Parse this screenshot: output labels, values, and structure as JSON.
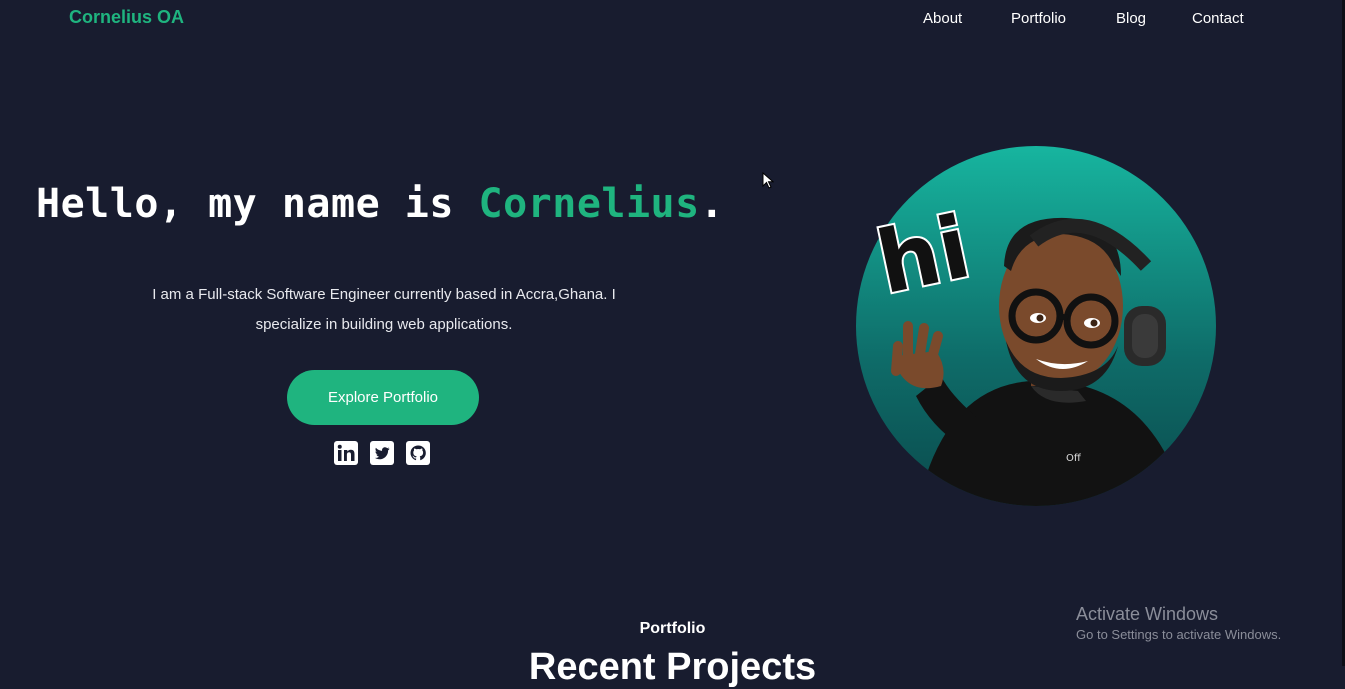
{
  "brand": {
    "name": "Cornelius OA",
    "color": "#1fb47f"
  },
  "nav": {
    "items": [
      "About",
      "Portfolio",
      "Blog",
      "Contact"
    ]
  },
  "hero": {
    "greeting_prefix": "Hello, my name is ",
    "greeting_name": "Cornelius",
    "greeting_suffix": ".",
    "intro": "I am a Full-stack Software Engineer currently based in Accra,Ghana. I specialize in building web applications.",
    "cta_label": "Explore Portfolio",
    "socials": [
      "linkedin-icon",
      "twitter-icon",
      "github-icon"
    ],
    "avatar": {
      "kind": "bitmoji avatar",
      "bubble_text": "hi"
    }
  },
  "portfolio_section": {
    "label": "Portfolio",
    "title": "Recent Projects"
  },
  "watermark": {
    "title": "Activate Windows",
    "subtitle": "Go to Settings to activate Windows."
  },
  "colors": {
    "background": "#181c2f",
    "accent": "#1fb47f",
    "text": "#ffffff"
  }
}
